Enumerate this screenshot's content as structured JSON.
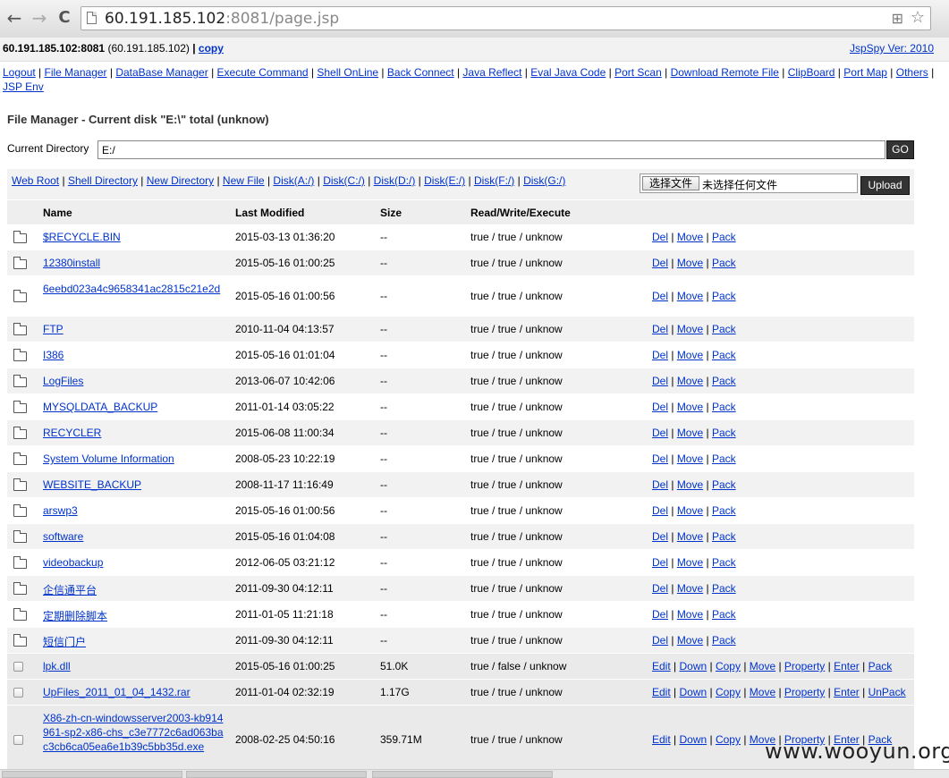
{
  "browser": {
    "back_glyph": "←",
    "forward_glyph": "→",
    "reload_glyph": "C",
    "url_host": "60.191.185.102",
    "url_port": ":8081",
    "url_path": "/page.jsp",
    "translate_glyph": "⊞",
    "star_glyph": "☆"
  },
  "header": {
    "host": "60.191.185.102:8081",
    "ip": "(60.191.185.102)",
    "pipe": "|",
    "copy_label": "copy",
    "version": "JspSpy Ver: 2010"
  },
  "menu": [
    "Logout",
    "File Manager",
    "DataBase Manager",
    "Execute Command",
    "Shell OnLine",
    "Back Connect",
    "Java Reflect",
    "Eval Java Code",
    "Port Scan",
    "Download Remote File",
    "ClipBoard",
    "Port Map",
    "Others",
    "JSP Env"
  ],
  "file_manager": {
    "title": "File Manager - Current disk \"E:\\\" total (unknow)",
    "dir_label": "Current Directory",
    "dir_value": "E:/",
    "go_label": "GO",
    "quick_links": [
      "Web Root",
      "Shell Directory",
      "New Directory",
      "New File",
      "Disk(A:/)",
      "Disk(C:/)",
      "Disk(D:/)",
      "Disk(E:/)",
      "Disk(F:/)",
      "Disk(G:/)"
    ],
    "choose_file_label": "选择文件",
    "no_file_text": "未选择任何文件",
    "upload_label": "Upload"
  },
  "table": {
    "headers": {
      "name": "Name",
      "modified": "Last Modified",
      "size": "Size",
      "rwx": "Read/Write/Execute"
    },
    "folder_actions": [
      "Del",
      "Move",
      "Pack"
    ],
    "folders": [
      {
        "name": "$RECYCLE.BIN",
        "modified": "2015-03-13 01:36:20",
        "size": "--",
        "rwx": "true / true / unknow"
      },
      {
        "name": "12380install",
        "modified": "2015-05-16 01:00:25",
        "size": "--",
        "rwx": "true / true / unknow"
      },
      {
        "name": "6eebd023a4c9658341ac2815c21e2d",
        "modified": "2015-05-16 01:00:56",
        "size": "--",
        "rwx": "true / true / unknow"
      },
      {
        "name": "FTP",
        "modified": "2010-11-04 04:13:57",
        "size": "--",
        "rwx": "true / true / unknow"
      },
      {
        "name": "I386",
        "modified": "2015-05-16 01:01:04",
        "size": "--",
        "rwx": "true / true / unknow"
      },
      {
        "name": "LogFiles",
        "modified": "2013-06-07 10:42:06",
        "size": "--",
        "rwx": "true / true / unknow"
      },
      {
        "name": "MYSQLDATA_BACKUP",
        "modified": "2011-01-14 03:05:22",
        "size": "--",
        "rwx": "true / true / unknow"
      },
      {
        "name": "RECYCLER",
        "modified": "2015-06-08 11:00:34",
        "size": "--",
        "rwx": "true / true / unknow"
      },
      {
        "name": "System Volume Information",
        "modified": "2008-05-23 10:22:19",
        "size": "--",
        "rwx": "true / true / unknow"
      },
      {
        "name": "WEBSITE_BACKUP",
        "modified": "2008-11-17 11:16:49",
        "size": "--",
        "rwx": "true / true / unknow"
      },
      {
        "name": "arswp3",
        "modified": "2015-05-16 01:00:56",
        "size": "--",
        "rwx": "true / true / unknow"
      },
      {
        "name": "software",
        "modified": "2015-05-16 01:04:08",
        "size": "--",
        "rwx": "true / true / unknow"
      },
      {
        "name": "videobackup",
        "modified": "2012-06-05 03:21:12",
        "size": "--",
        "rwx": "true / true / unknow"
      },
      {
        "name": "企信通平台",
        "modified": "2011-09-30 04:12:11",
        "size": "--",
        "rwx": "true / true / unknow"
      },
      {
        "name": "定期删除脚本",
        "modified": "2011-01-05 11:21:18",
        "size": "--",
        "rwx": "true / true / unknow"
      },
      {
        "name": "短信门户",
        "modified": "2011-09-30 04:12:11",
        "size": "--",
        "rwx": "true / true / unknow"
      }
    ],
    "files": [
      {
        "name": "lpk.dll",
        "modified": "2015-05-16 01:00:25",
        "size": "51.0K",
        "rwx": "true / false / unknow",
        "actions": [
          "Edit",
          "Down",
          "Copy",
          "Move",
          "Property",
          "Enter",
          "Pack"
        ]
      },
      {
        "name": "UpFiles_2011_01_04_1432.rar",
        "modified": "2011-01-04 02:32:19",
        "size": "1.17G",
        "rwx": "true / true / unknow",
        "actions": [
          "Edit",
          "Down",
          "Copy",
          "Move",
          "Property",
          "Enter",
          "UnPack"
        ]
      },
      {
        "name": "X86-zh-cn-windowsserver2003-kb914961-sp2-x86-chs_c3e7772c6ad063bac3cb6ca05ea6e1b39c5bb35d.exe",
        "modified": "2008-02-25 04:50:16",
        "size": "359.71M",
        "rwx": "true / true / unknow",
        "actions": [
          "Edit",
          "Down",
          "Copy",
          "Move",
          "Property",
          "Enter",
          "Pack"
        ]
      }
    ]
  },
  "watermark": "www.wooyun.org"
}
